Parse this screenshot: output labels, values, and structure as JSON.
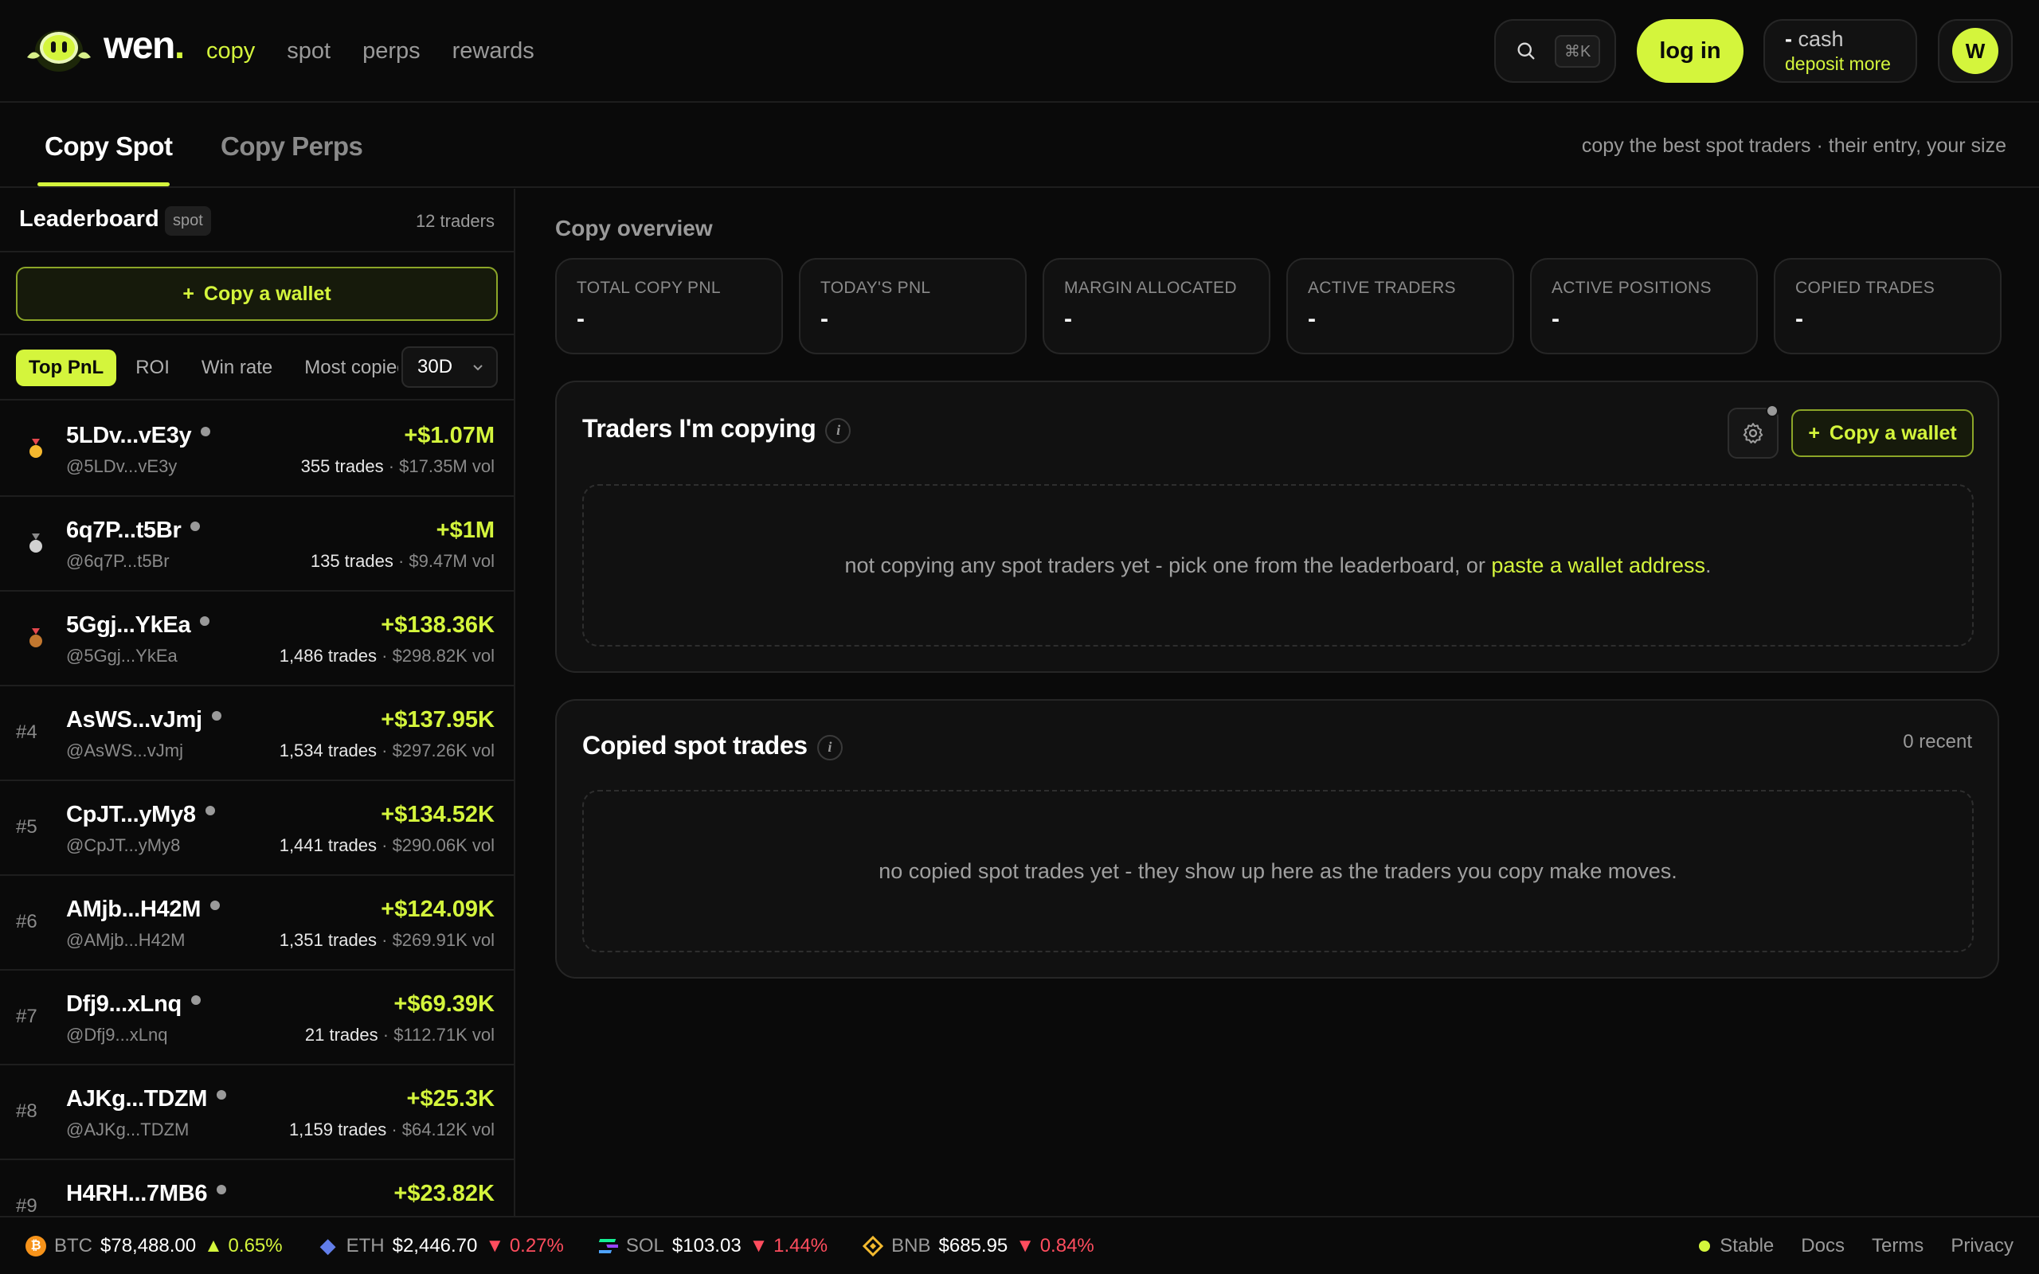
{
  "brand": {
    "name": "wen",
    "dot": "."
  },
  "nav": {
    "links": [
      "copy",
      "spot",
      "perps",
      "rewards"
    ]
  },
  "header": {
    "search_shortcut": "⌘K",
    "login_label": "log in",
    "cash_value": "-",
    "cash_label": "cash",
    "deposit_label": "deposit more",
    "avatar_initial": "W"
  },
  "tabs": {
    "spot": "Copy Spot",
    "perps": "Copy Perps",
    "tagline": "copy the best spot traders · their entry, your size"
  },
  "leaderboard": {
    "title": "Leaderboard",
    "chip": "spot",
    "count": "12 traders",
    "copy_wallet_label": "Copy a wallet",
    "filters": [
      "Top PnL",
      "ROI",
      "Win rate",
      "Most copied"
    ],
    "period": "30D",
    "rows": [
      {
        "rank": "",
        "name": "5LDv...vE3y",
        "handle": "@5LDv...vE3y",
        "pnl": "+$1.07M",
        "trades": "355 trades",
        "vol": " · $17.35M vol"
      },
      {
        "rank": "",
        "name": "6q7P...t5Br",
        "handle": "@6q7P...t5Br",
        "pnl": "+$1M",
        "trades": "135 trades",
        "vol": " · $9.47M vol"
      },
      {
        "rank": "",
        "name": "5Ggj...YkEa",
        "handle": "@5Ggj...YkEa",
        "pnl": "+$138.36K",
        "trades": "1,486 trades",
        "vol": " · $298.82K vol"
      },
      {
        "rank": "#4",
        "name": "AsWS...vJmj",
        "handle": "@AsWS...vJmj",
        "pnl": "+$137.95K",
        "trades": "1,534 trades",
        "vol": " · $297.26K vol"
      },
      {
        "rank": "#5",
        "name": "CpJT...yMy8",
        "handle": "@CpJT...yMy8",
        "pnl": "+$134.52K",
        "trades": "1,441 trades",
        "vol": " · $290.06K vol"
      },
      {
        "rank": "#6",
        "name": "AMjb...H42M",
        "handle": "@AMjb...H42M",
        "pnl": "+$124.09K",
        "trades": "1,351 trades",
        "vol": " · $269.91K vol"
      },
      {
        "rank": "#7",
        "name": "Dfj9...xLnq",
        "handle": "@Dfj9...xLnq",
        "pnl": "+$69.39K",
        "trades": "21 trades",
        "vol": " · $112.71K vol"
      },
      {
        "rank": "#8",
        "name": "AJKg...TDZM",
        "handle": "@AJKg...TDZM",
        "pnl": "+$25.3K",
        "trades": "1,159 trades",
        "vol": " · $64.12K vol"
      },
      {
        "rank": "#9",
        "name": "H4RH...7MB6",
        "handle": "",
        "pnl": "+$23.82K",
        "trades": "",
        "vol": ""
      }
    ]
  },
  "overview": {
    "title": "Copy overview",
    "stats": [
      {
        "label": "TOTAL COPY PNL",
        "value": "-"
      },
      {
        "label": "TODAY'S PNL",
        "value": "-"
      },
      {
        "label": "MARGIN ALLOCATED",
        "value": "-"
      },
      {
        "label": "ACTIVE TRADERS",
        "value": "-"
      },
      {
        "label": "ACTIVE POSITIONS",
        "value": "-"
      },
      {
        "label": "COPIED TRADES",
        "value": "-"
      }
    ]
  },
  "copying": {
    "title": "Traders I'm copying",
    "copy_wallet_label": "Copy a wallet",
    "empty_text": "not copying any spot traders yet - pick one from the leaderboard, or ",
    "empty_link": "paste a wallet address",
    "empty_end": "."
  },
  "copied_trades": {
    "title": "Copied spot trades",
    "recent": "0 recent",
    "empty_text": "no copied spot trades yet - they show up here as the traders you copy make moves."
  },
  "ticker": [
    {
      "symbol": "BTC",
      "price": "$78,488.00",
      "change": "0.65%",
      "dir": "up",
      "icon": "bitcoin-icon",
      "color": "#f7931a"
    },
    {
      "symbol": "ETH",
      "price": "$2,446.70",
      "change": "0.27%",
      "dir": "down",
      "icon": "ethereum-icon",
      "color": "#627eea"
    },
    {
      "symbol": "SOL",
      "price": "$103.03",
      "change": "1.44%",
      "dir": "down",
      "icon": "solana-icon",
      "color": "#9945ff"
    },
    {
      "symbol": "BNB",
      "price": "$685.95",
      "change": "0.84%",
      "dir": "down",
      "icon": "bnb-icon",
      "color": "#f3ba2f"
    }
  ],
  "footer": {
    "status": "Stable",
    "links": [
      "Docs",
      "Terms",
      "Privacy"
    ]
  },
  "colors": {
    "accent": "#d4f53c",
    "down": "#ff4d5e",
    "bg": "#0a0a0a"
  }
}
